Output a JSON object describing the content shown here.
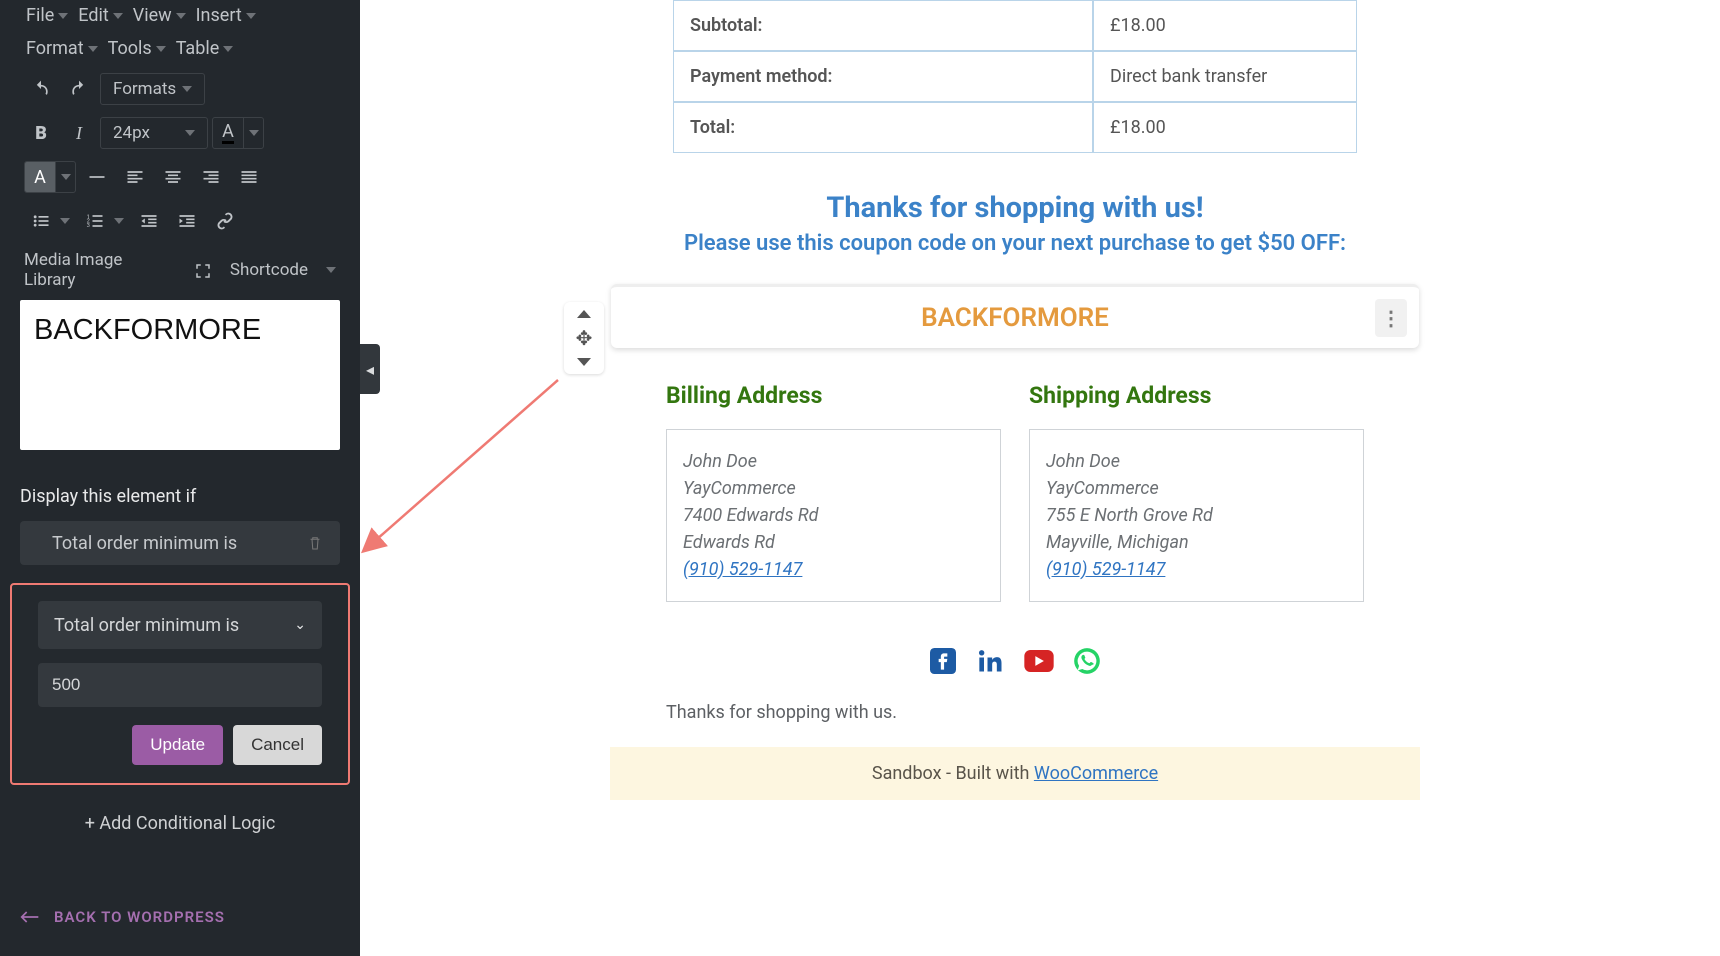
{
  "sidebar": {
    "menus": {
      "file": "File",
      "edit": "Edit",
      "view": "View",
      "insert": "Insert",
      "format": "Format",
      "tools": "Tools",
      "table": "Table"
    },
    "formats_label": "Formats",
    "fontsize_label": "24px",
    "media_label": "Media Image Library",
    "shortcode_label": "Shortcode",
    "editor_content": "BACKFORMORE",
    "conditions_title": "Display this element if",
    "condition_pill": "Total order minimum is",
    "condition_select": "Total order minimum is",
    "condition_value": "500",
    "update_label": "Update",
    "cancel_label": "Cancel",
    "add_logic_label": "+ Add Conditional Logic",
    "back_label": "BACK TO WORDPRESS"
  },
  "preview": {
    "table": [
      {
        "label": "Subtotal:",
        "value": "£18.00"
      },
      {
        "label": "Payment method:",
        "value": "Direct bank transfer"
      },
      {
        "label": "Total:",
        "value": "£18.00"
      }
    ],
    "thanks_title": "Thanks for shopping with us!",
    "thanks_sub": "Please use this coupon code on your next purchase to get $50 OFF:",
    "coupon": "BACKFORMORE",
    "addresses": {
      "billing_heading": "Billing Address",
      "shipping_heading": "Shipping Address",
      "billing": {
        "name": "John Doe",
        "company": "YayCommerce",
        "line1": "7400 Edwards Rd",
        "line2": "Edwards Rd",
        "phone": "(910) 529-1147"
      },
      "shipping": {
        "name": "John Doe",
        "company": "YayCommerce",
        "line1": "755 E North Grove Rd",
        "line2": "Mayville, Michigan",
        "phone": "(910) 529-1147"
      }
    },
    "footer_text": "Thanks for shopping with us.",
    "sandbox_prefix": "Sandbox - Built with ",
    "sandbox_link": "WooCommerce"
  }
}
